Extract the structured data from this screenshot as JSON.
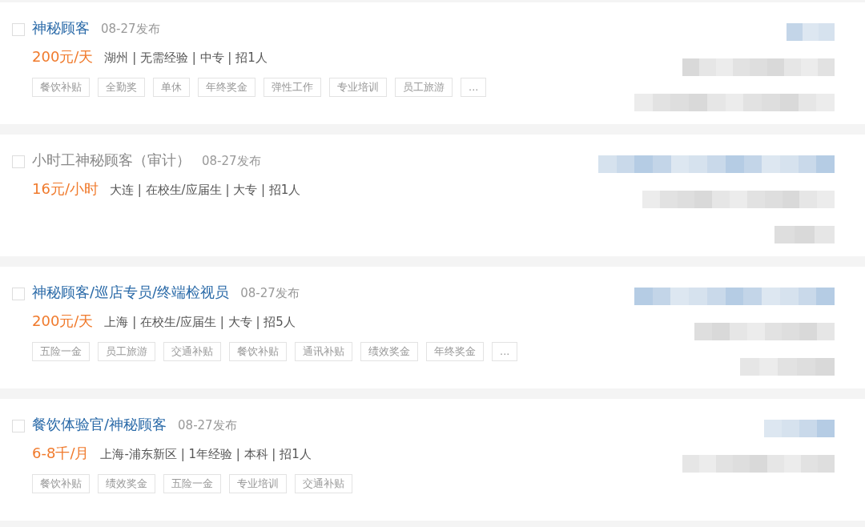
{
  "jobs": [
    {
      "title": "神秘顾客",
      "visited": false,
      "checked": false,
      "date": "08-27发布",
      "salary": "200元/天",
      "info": "湖州 | 无需经验 | 中专 | 招1人",
      "tags": [
        "餐饮补贴",
        "全勤奖",
        "单休",
        "年终奖金",
        "弹性工作",
        "专业培训",
        "员工旅游",
        "..."
      ],
      "redactions": [
        {
          "kind": "link"
        },
        {
          "kind": "text"
        },
        {
          "kind": "text"
        }
      ]
    },
    {
      "title": "小时工神秘顾客（审计）",
      "visited": true,
      "checked": false,
      "date": "08-27发布",
      "salary": "16元/小时",
      "info": "大连 | 在校生/应届生 | 大专 | 招1人",
      "redactions": [
        {
          "kind": "link"
        },
        {
          "kind": "text"
        },
        {
          "kind": "text"
        }
      ]
    },
    {
      "title": "神秘顾客/巡店专员/终端检视员",
      "visited": false,
      "checked": false,
      "date": "08-27发布",
      "salary": "200元/天",
      "info": "上海 | 在校生/应届生 | 大专 | 招5人",
      "tags": [
        "五险一金",
        "员工旅游",
        "交通补贴",
        "餐饮补贴",
        "通讯补贴",
        "绩效奖金",
        "年终奖金",
        "..."
      ],
      "redactions": [
        {
          "kind": "link"
        },
        {
          "kind": "text"
        },
        {
          "kind": "text"
        }
      ]
    },
    {
      "title": "餐饮体验官/神秘顾客",
      "visited": false,
      "checked": false,
      "date": "08-27发布",
      "salary": "6-8千/月",
      "info": "上海-浦东新区 | 1年经验 | 本科 | 招1人",
      "tags": [
        "餐饮补贴",
        "绩效奖金",
        "五险一金",
        "专业培训",
        "交通补贴"
      ],
      "redactions": [
        {
          "kind": "link"
        },
        {
          "kind": "text"
        }
      ]
    }
  ]
}
